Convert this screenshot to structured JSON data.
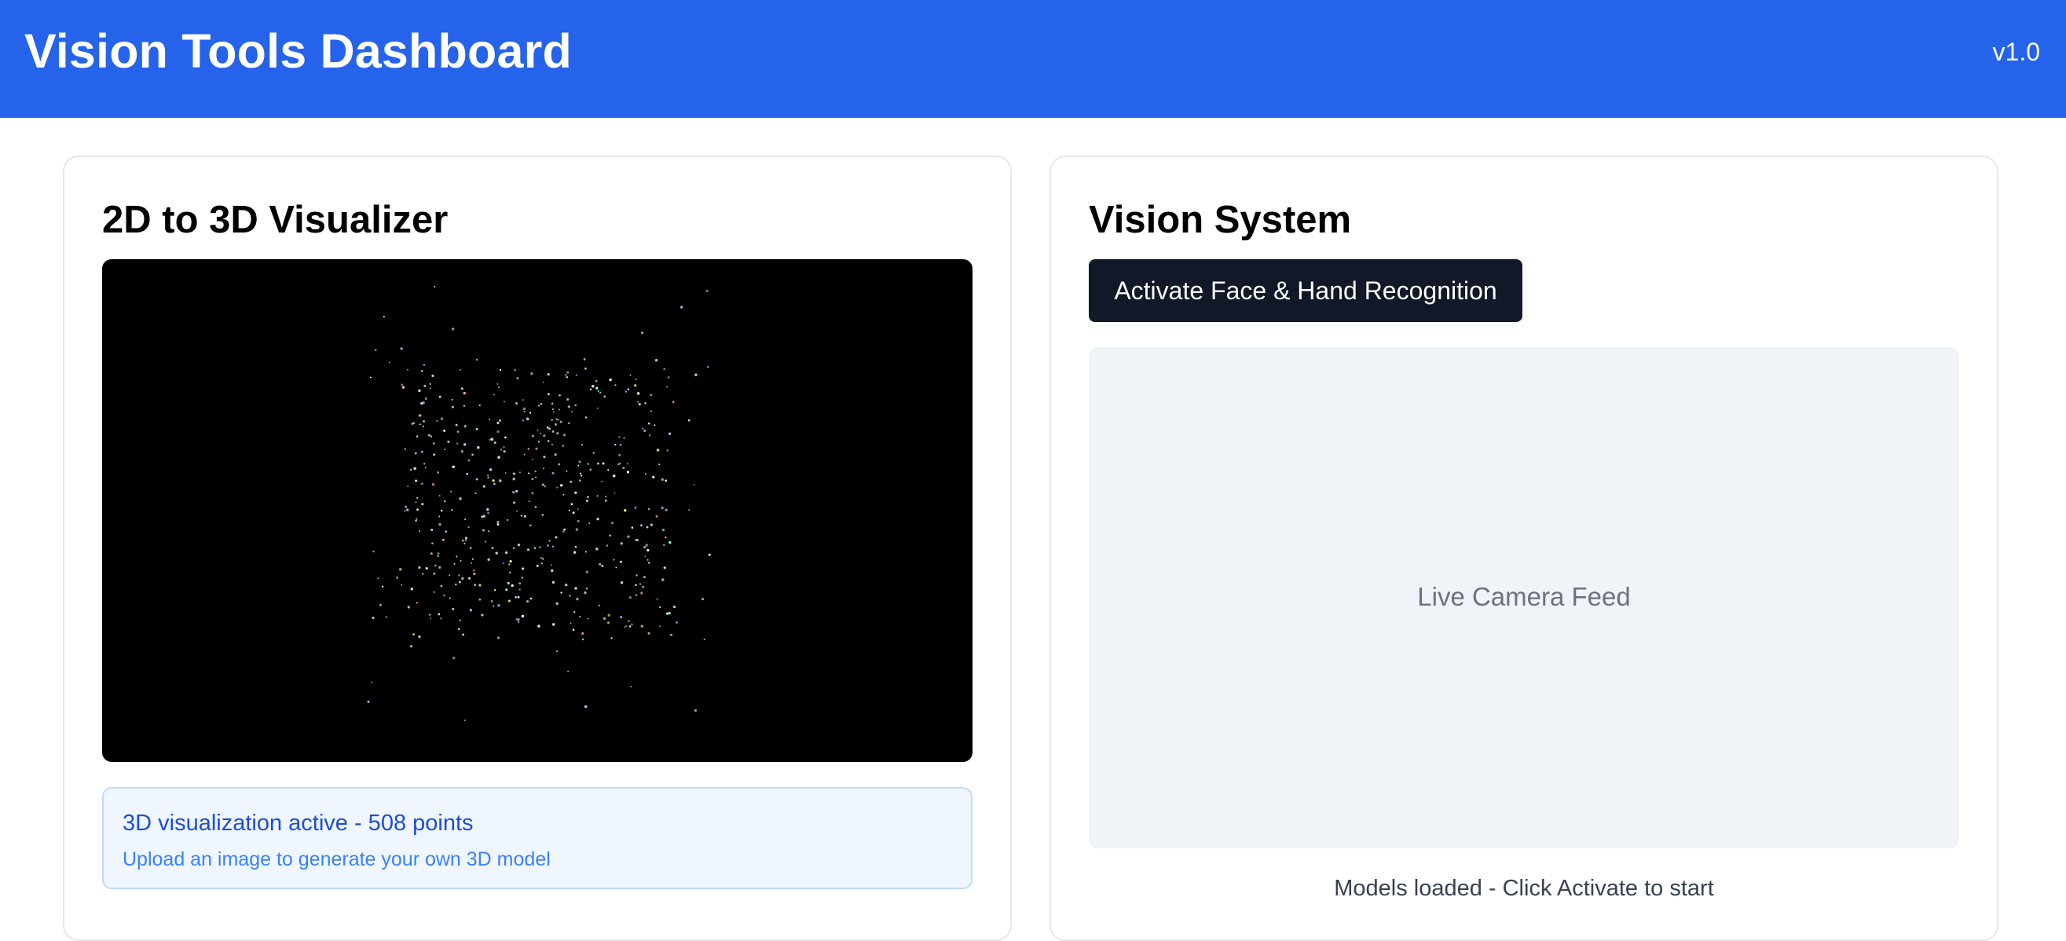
{
  "header": {
    "title": "Vision Tools Dashboard",
    "version": "v1.0",
    "background_color": "#2563eb"
  },
  "visualizer": {
    "title": "2D to 3D Visualizer",
    "point_count": 508,
    "status_primary": "3D visualization active - 508 points",
    "status_secondary": "Upload an image to generate your own 3D model"
  },
  "vision_system": {
    "title": "Vision System",
    "activate_label": "Activate Face & Hand Recognition",
    "camera_placeholder": "Live Camera Feed",
    "models_status": "Models loaded - Click Activate to start"
  }
}
